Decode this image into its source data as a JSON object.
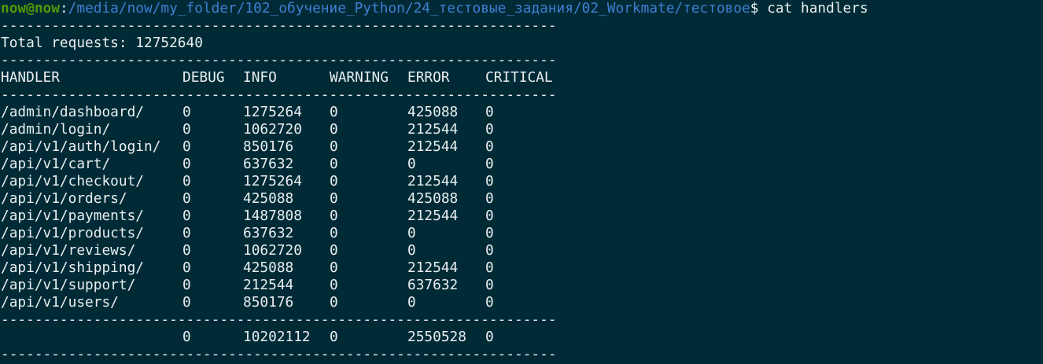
{
  "prompt": {
    "user_host": "now@now",
    "separator": ":",
    "path": "/media/now/my_folder/102_обучение_Python/24_тестовые_задания/02_Workmate/тестовое",
    "symbol": "$ ",
    "command": "cat handlers"
  },
  "colors": {
    "background": "#002b36",
    "text": "#e8eef0",
    "user_host": "#4e9a06",
    "path": "#3f7fd4"
  },
  "rule": "------------------------------------------------------------------",
  "total_line": "Total requests: 12752640",
  "table": {
    "headers": [
      "HANDLER",
      "DEBUG",
      "INFO",
      "WARNING",
      "ERROR",
      "CRITICAL"
    ],
    "rows": [
      [
        "/admin/dashboard/",
        "0",
        "1275264",
        "0",
        "425088",
        "0"
      ],
      [
        "/admin/login/",
        "0",
        "1062720",
        "0",
        "212544",
        "0"
      ],
      [
        "/api/v1/auth/login/",
        "0",
        "850176",
        "0",
        "212544",
        "0"
      ],
      [
        "/api/v1/cart/",
        "0",
        "637632",
        "0",
        "0",
        "0"
      ],
      [
        "/api/v1/checkout/",
        "0",
        "1275264",
        "0",
        "212544",
        "0"
      ],
      [
        "/api/v1/orders/",
        "0",
        "425088",
        "0",
        "425088",
        "0"
      ],
      [
        "/api/v1/payments/",
        "0",
        "1487808",
        "0",
        "212544",
        "0"
      ],
      [
        "/api/v1/products/",
        "0",
        "637632",
        "0",
        "0",
        "0"
      ],
      [
        "/api/v1/reviews/",
        "0",
        "1062720",
        "0",
        "0",
        "0"
      ],
      [
        "/api/v1/shipping/",
        "0",
        "425088",
        "0",
        "212544",
        "0"
      ],
      [
        "/api/v1/support/",
        "0",
        "212544",
        "0",
        "637632",
        "0"
      ],
      [
        "/api/v1/users/",
        "0",
        "850176",
        "0",
        "0",
        "0"
      ]
    ],
    "totals": [
      "",
      "0",
      "10202112",
      "0",
      "2550528",
      "0"
    ]
  }
}
